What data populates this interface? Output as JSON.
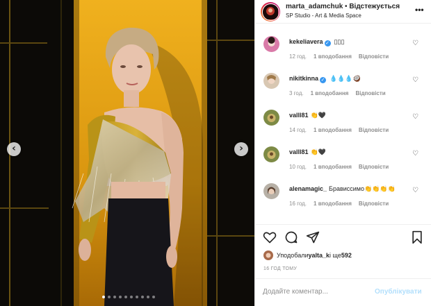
{
  "header": {
    "username": "marta_adamchuk",
    "separator": " • ",
    "follow_label": "Відстежується",
    "location": "SP Studio - Art & Media Space"
  },
  "comments": [
    {
      "user": "kekeliavera",
      "verified": true,
      "text": "▯▯▯",
      "time": "12 год.",
      "likes": "1 вподобання",
      "reply": "Відповісти",
      "avatar": "pink"
    },
    {
      "user": "nikitkinna",
      "verified": true,
      "text": "💧💧💧🥥",
      "time": "3 год.",
      "likes": "1 вподобання",
      "reply": "Відповісти",
      "avatar": "tan"
    },
    {
      "user": "valll81",
      "verified": false,
      "text": "👏🖤",
      "time": "14 год.",
      "likes": "1 вподобання",
      "reply": "Відповісти",
      "avatar": "green"
    },
    {
      "user": "valll81",
      "verified": false,
      "text": "👏🖤",
      "time": "10 год.",
      "likes": "1 вподобання",
      "reply": "Відповісти",
      "avatar": "green"
    },
    {
      "user": "alenamagic_",
      "verified": false,
      "text": "Брависсимо👏👏👏👏",
      "time": "16 год.",
      "likes": "1 вподобання",
      "reply": "Відповісти",
      "avatar": "gray"
    }
  ],
  "actions": {
    "liked_prefix": "Уподобали ",
    "liked_user": "yalta_k",
    "liked_suffix": " і ще ",
    "liked_count": "592",
    "timestamp": "16 ГОД ТОМУ"
  },
  "comment_box": {
    "placeholder": "Додайте коментар...",
    "post_label": "Опублікувати"
  },
  "carousel": {
    "total": 10,
    "active": 1
  },
  "icons": {
    "like": "heart-icon",
    "comment": "comment-icon",
    "share": "share-icon",
    "save": "bookmark-icon",
    "prev": "chevron-left-icon",
    "next": "chevron-right-icon",
    "more": "more-icon"
  }
}
